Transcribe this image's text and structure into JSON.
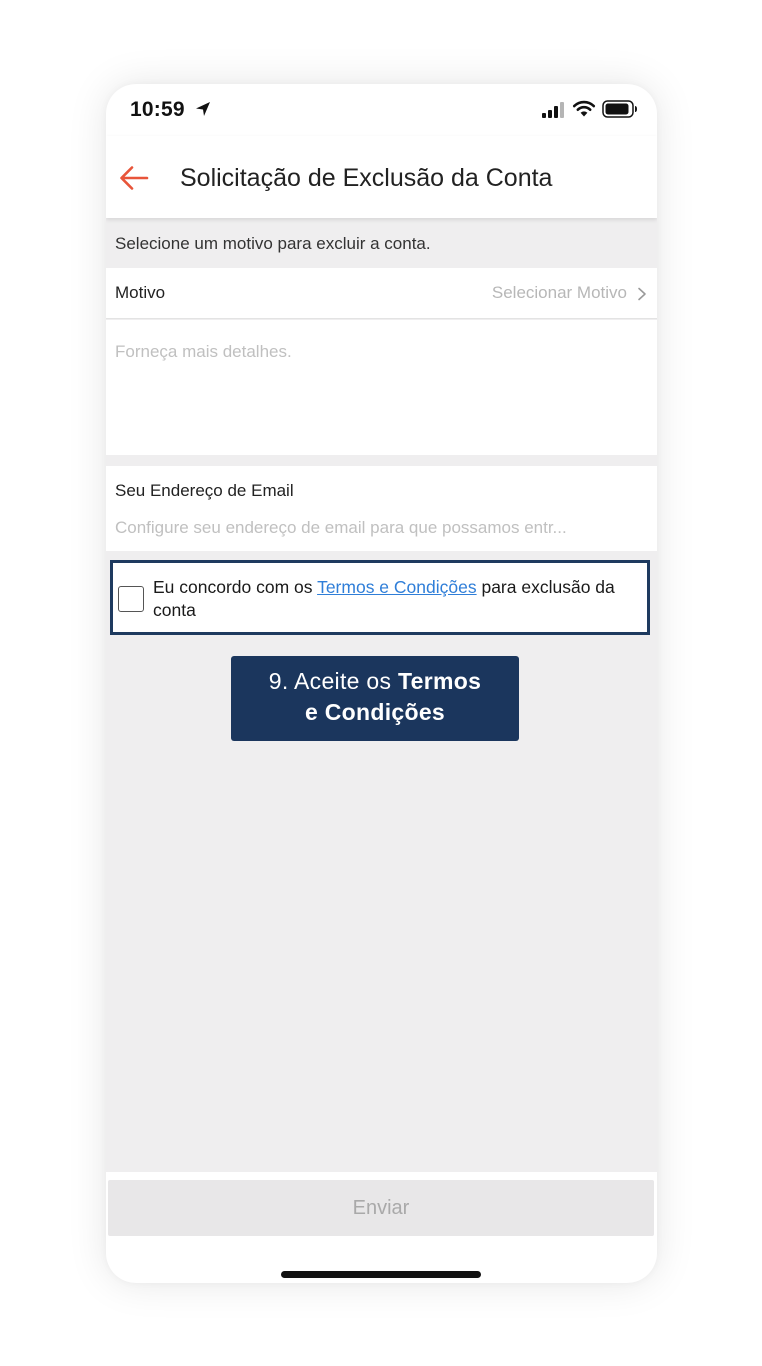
{
  "status_bar": {
    "time": "10:59"
  },
  "header": {
    "title": "Solicitação de Exclusão da Conta"
  },
  "form": {
    "hint": "Selecione um motivo para excluir a conta.",
    "reason_label": "Motivo",
    "reason_value": "Selecionar Motivo",
    "details_placeholder": "Forneça mais detalhes.",
    "email_label": "Seu Endereço de Email",
    "email_placeholder": "Configure seu endereço de email para que possamos entr..."
  },
  "terms": {
    "prefix": "Eu concordo com os ",
    "link": "Termos e Condições",
    "suffix": " para exclusão da conta"
  },
  "callout": {
    "prefix": "9. Aceite os ",
    "bold1": "Termos",
    "bold2": "e Condições"
  },
  "footer": {
    "submit_label": "Enviar"
  },
  "colors": {
    "accent": "#e8553a",
    "callout_bg": "#1b365d",
    "link": "#2f7ed8"
  }
}
